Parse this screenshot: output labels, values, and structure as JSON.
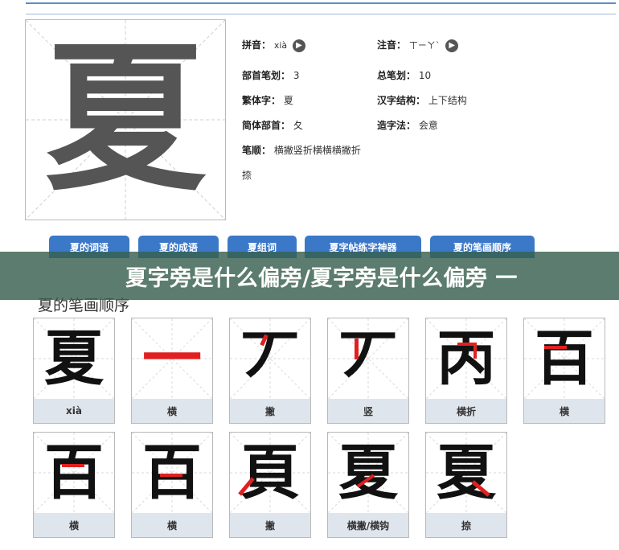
{
  "character": "夏",
  "info": {
    "pinyin_label": "拼音：",
    "pinyin_value": "xià",
    "zhuyin_label": "注音：",
    "zhuyin_value": "ㄒㄧㄚˋ",
    "radical_strokes_label": "部首笔划：",
    "radical_strokes_value": "3",
    "total_strokes_label": "总笔划：",
    "total_strokes_value": "10",
    "traditional_label": "繁体字：",
    "traditional_value": "夏",
    "structure_label": "汉字结构：",
    "structure_value": "上下结构",
    "simplified_radical_label": "简体部首：",
    "simplified_radical_value": "夂",
    "formation_label": "造字法：",
    "formation_value": "会意",
    "stroke_order_label": "笔顺：",
    "stroke_order_value_line1": "横撇竖折横横横撇折",
    "stroke_order_value_line2": "捺"
  },
  "tabs": [
    {
      "label": "夏的词语"
    },
    {
      "label": "夏的成语"
    },
    {
      "label": "夏组词"
    },
    {
      "label": "夏字帖练字神器"
    },
    {
      "label": "夏的笔画顺序"
    }
  ],
  "banner": {
    "text": "夏字旁是什么偏旁/夏字旁是什么偏旁 一"
  },
  "section_title": "夏的笔画顺序",
  "strokes": [
    {
      "char": "夏",
      "label": "xià"
    },
    {
      "char": "一",
      "label": "横"
    },
    {
      "char": "丆",
      "label": "撇"
    },
    {
      "char": "丆",
      "label": "竖"
    },
    {
      "char": "丙",
      "label": "横折"
    },
    {
      "char": "百",
      "label": "横"
    },
    {
      "char": "百",
      "label": "横"
    },
    {
      "char": "百",
      "label": "横"
    },
    {
      "char": "頁",
      "label": "撇"
    },
    {
      "char": "夏",
      "label": "横撇/横钩"
    },
    {
      "char": "夏",
      "label": "捺"
    }
  ],
  "colors": {
    "tab_bg": "#3b78c8",
    "stroke_highlight": "#e02020",
    "banner_bg": "#375f4e"
  }
}
